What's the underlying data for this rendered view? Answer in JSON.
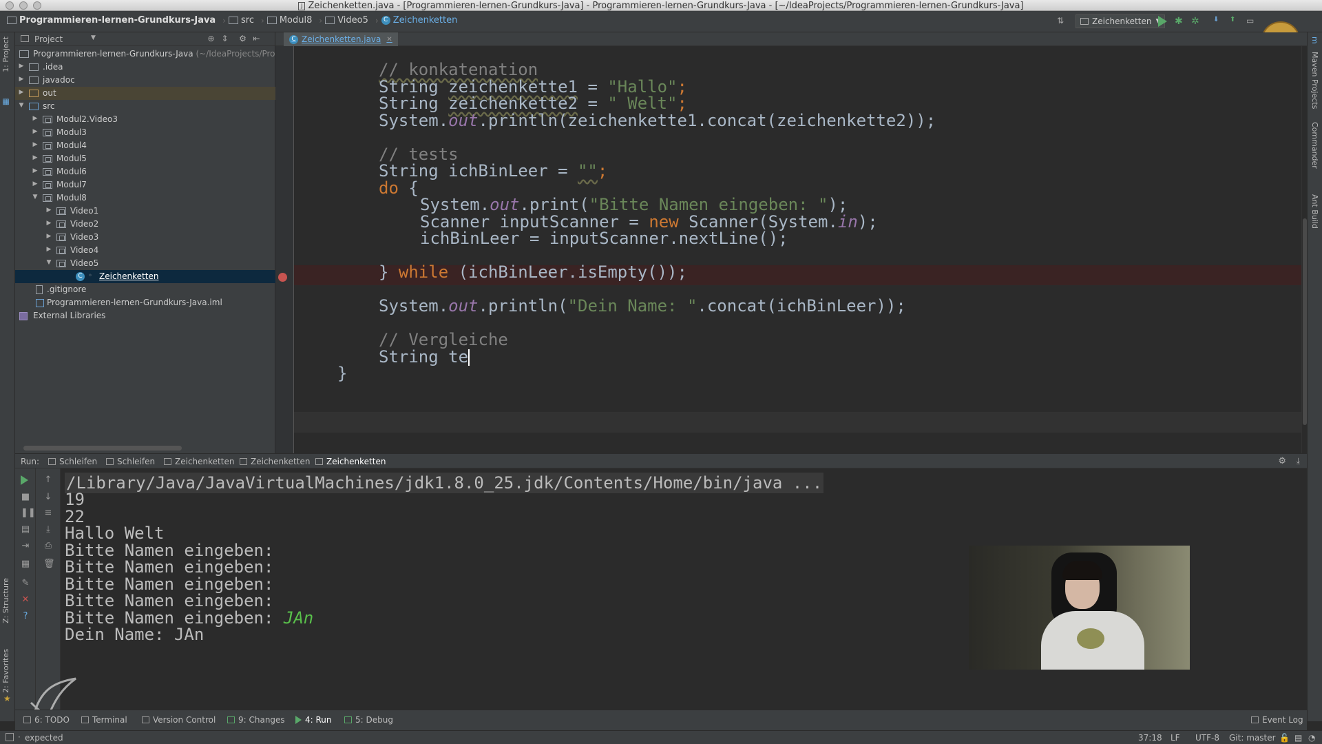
{
  "window": {
    "title": "Zeichenketten.java - [Programmieren-lernen-Grundkurs-Java] - Programmieren-lernen-Grundkurs-Java - [~/IdeaProjects/Programmieren-lernen-Grundkurs-Java]"
  },
  "navbar": {
    "crumbs": [
      "Programmieren-lernen-Grundkurs-Java",
      "src",
      "Modul8",
      "Video5",
      "Zeichenketten"
    ],
    "run_config": "Zeichenketten"
  },
  "project_panel": {
    "header": "Project",
    "root": "Programmieren-lernen-Grundkurs-Java",
    "root_path": "(~/IdeaProjects/Pro",
    "items": [
      ".idea",
      "javadoc",
      "out",
      "src",
      "Modul2.Video3",
      "Modul3",
      "Modul4",
      "Modul5",
      "Modul6",
      "Modul7",
      "Modul8",
      "Video1",
      "Video2",
      "Video3",
      "Video4",
      "Video5",
      "Zeichenketten",
      ".gitignore",
      "Programmieren-lernen-Grundkurs-Java.iml",
      "External Libraries"
    ]
  },
  "left_strip": {
    "project": "1: Project",
    "structure": "Z: Structure",
    "favorites": "2: Favorites"
  },
  "right_strip": {
    "maven": "Maven Projects",
    "commander": "Commander",
    "ant": "Ant Build"
  },
  "editor": {
    "tab": "Zeichenketten.java",
    "code": {
      "l1": "// konkatenation",
      "l2a": "String ",
      "l2b": "zeichenkette1",
      "l2c": " = ",
      "l2d": "\"Hallo\"",
      "l2e": ";",
      "l3a": "String ",
      "l3b": "zeichenkette2",
      "l3c": " = ",
      "l3d": "\" Welt\"",
      "l3e": ";",
      "l4a": "System.",
      "l4b": "out",
      "l4c": ".println(zeichenkette1.concat(zeichenkette2));",
      "l6": "// tests",
      "l7a": "String ichBinLeer = ",
      "l7b": "\"\"",
      "l7c": ";",
      "l8a": "do",
      "l8b": " {",
      "l9a": "System.",
      "l9b": "out",
      "l9c": ".print(",
      "l9d": "\"Bitte Namen eingeben: \"",
      "l9e": ");",
      "l10a": "Scanner inputScanner = ",
      "l10b": "new",
      "l10c": " Scanner(System.",
      "l10d": "in",
      "l10e": ");",
      "l11": "ichBinLeer = inputScanner.nextLine();",
      "l13a": "} ",
      "l13b": "while",
      "l13c": " (ichBinLeer.isEmpty());",
      "l15a": "System.",
      "l15b": "out",
      "l15c": ".println(",
      "l15d": "\"Dein Name: \"",
      "l15e": ".concat(ichBinLeer));",
      "l17": "// Vergleiche",
      "l18": "String te",
      "l19": "}"
    }
  },
  "run_panel": {
    "label": "Run:",
    "tabs": [
      "Schleifen",
      "Schleifen",
      "Zeichenketten",
      "Zeichenketten",
      "Zeichenketten"
    ],
    "console": {
      "cmd": "/Library/Java/JavaVirtualMachines/jdk1.8.0_25.jdk/Contents/Home/bin/java ...",
      "out1": "19",
      "out2": "22",
      "out3": "Hallo Welt",
      "prompt": "Bitte Namen eingeben:",
      "prompt_sp": "Bitte Namen eingeben: ",
      "input": "JAn",
      "result": "Dein Name: JAn"
    }
  },
  "bottom_tools": {
    "todo": "6: TODO",
    "terminal": "Terminal",
    "vcs": "Version Control",
    "changes": "9: Changes",
    "run": "4: Run",
    "debug": "5: Debug",
    "event_log": "Event Log"
  },
  "status": {
    "message": "expected",
    "position": "37:18",
    "line_sep": "LF",
    "encoding": "UTF-8",
    "git": "Git: master"
  }
}
